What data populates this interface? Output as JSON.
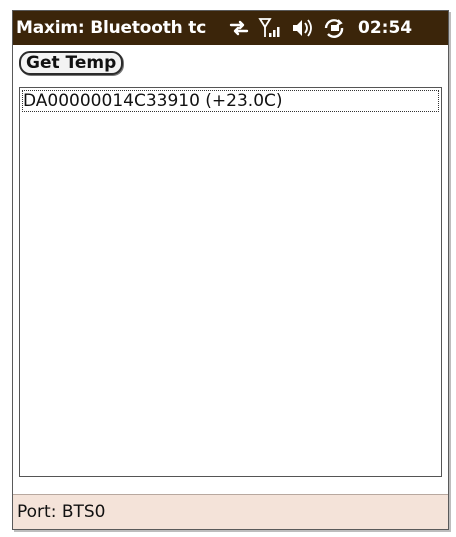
{
  "titlebar": {
    "title": "Maxim: Bluetooth tc",
    "time": "02:54",
    "icons": [
      "sync-arrows-icon",
      "signal-strength-icon",
      "speaker-icon",
      "battery-charging-icon"
    ]
  },
  "toolbar": {
    "get_temp_label": "Get Temp"
  },
  "list": {
    "items": [
      {
        "text": "DA00000014C33910 (+23.0C)"
      }
    ]
  },
  "status": {
    "port_text": "Port: BTS0"
  },
  "colors": {
    "titlebar_bg": "#3b250a",
    "statusbar_bg": "#f4e3d9"
  }
}
